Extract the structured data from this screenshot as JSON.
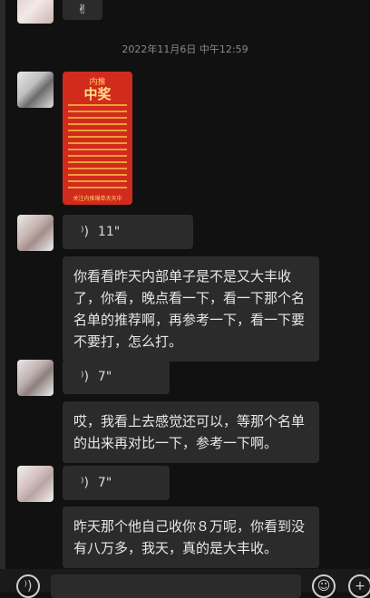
{
  "chat": {
    "timestamp": "2022年11月6日 中午12:59",
    "top_icon": "✌",
    "image_message": {
      "title_small": "内推",
      "title_big": "中奖",
      "footer": "关注内推爆单天天中"
    },
    "voice_1": {
      "duration": "11\""
    },
    "text_1": "你看看昨天内部单子是不是又大丰收了，你看，晚点看一下，看一下那个名名单的推荐啊，再参考一下，看一下要不要打，怎么打。",
    "voice_2": {
      "duration": "7\""
    },
    "text_2": "哎，我看上去感觉还可以，等那个名单的出来再对比一下，参考一下啊。",
    "voice_3": {
      "duration": "7\""
    },
    "text_3": "昨天那个他自己收你８万呢，你看到没有八万多，我天，真的是大丰收。"
  },
  "icons": {
    "voice_wave": "voice-wave-icon",
    "voice_input": "voice-input-icon",
    "emoji": "emoji-icon",
    "add": "add-icon"
  },
  "colors": {
    "background": "#111111",
    "bubble": "#2b2b2b",
    "text": "#e8e8e8",
    "timestamp": "#8a8a8a",
    "image_red": "#d22a1d"
  }
}
